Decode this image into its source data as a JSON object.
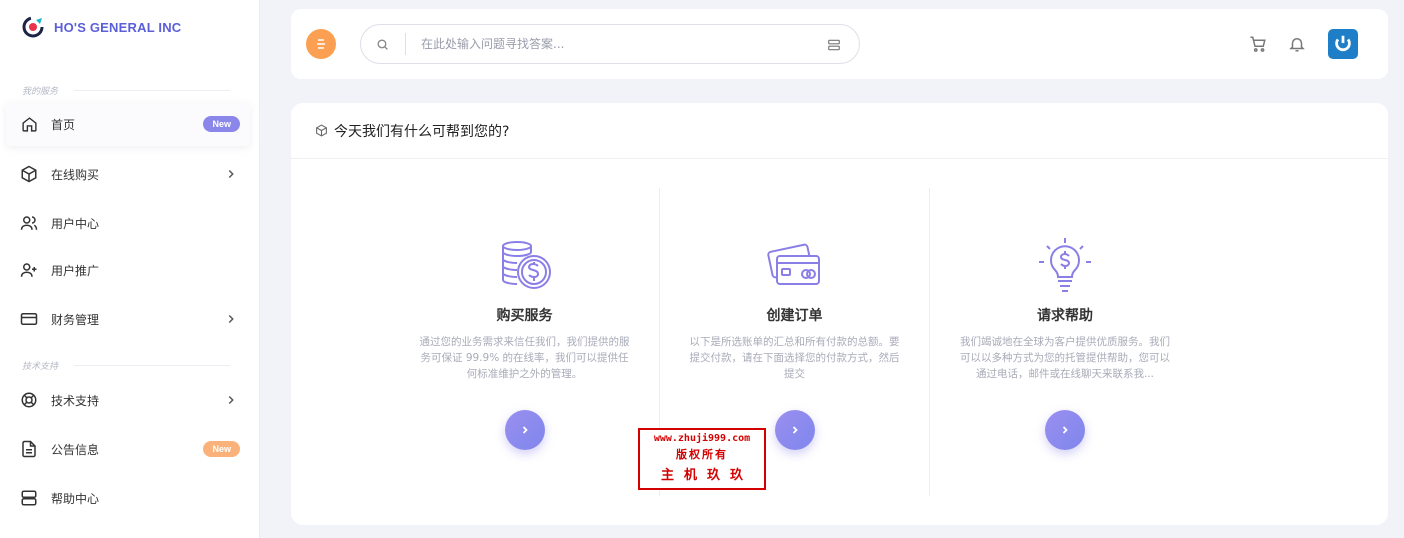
{
  "brand": {
    "name": "HO'S GENERAL INC",
    "accent": "#5b5fd8"
  },
  "sidebar": {
    "section_services": "我的服务",
    "section_support": "技术支持",
    "items": [
      {
        "label": "首页",
        "icon": "home-icon",
        "badge": "New",
        "badge_color": "#8b86ea"
      },
      {
        "label": "在线购买",
        "icon": "box-icon",
        "has_arrow": true
      },
      {
        "label": "用户中心",
        "icon": "users-icon"
      },
      {
        "label": "用户推广",
        "icon": "user-plus-icon"
      },
      {
        "label": "财务管理",
        "icon": "credit-card-icon",
        "has_arrow": true
      },
      {
        "label": "技术支持",
        "icon": "lifebuoy-icon",
        "has_arrow": true
      },
      {
        "label": "公告信息",
        "icon": "file-text-icon",
        "badge": "New",
        "badge_color": "#fbb27a"
      },
      {
        "label": "帮助中心",
        "icon": "server-icon"
      }
    ]
  },
  "topbar": {
    "search_placeholder": "在此处输入问题寻找答案..."
  },
  "card": {
    "title": "今天我们有什么可帮到您的?",
    "columns": [
      {
        "title": "购买服务",
        "icon": "coins-dollar-icon",
        "desc": "通过您的业务需求来信任我们，我们提供的服务可保证 99.9% 的在线率，我们可以提供任何标准维护之外的管理。"
      },
      {
        "title": "创建订单",
        "icon": "credit-cards-icon",
        "desc": "以下是所选账单的汇总和所有付款的总额。要提交付款，请在下面选择您的付款方式，然后提交"
      },
      {
        "title": "请求帮助",
        "icon": "lightbulb-dollar-icon",
        "desc": "我们竭诚地在全球为客户提供优质服务。我们可以以多种方式为您的托管提供帮助，您可以通过电话，邮件或在线聊天来联系我..."
      }
    ]
  },
  "watermark": {
    "line1": "www.zhuji999.com",
    "line2": "版权所有",
    "line3": "主机玖玖"
  },
  "colors": {
    "orange": "#fb9f52",
    "purple": "#8b86ea",
    "avatar_blue": "#1e7ec8"
  }
}
